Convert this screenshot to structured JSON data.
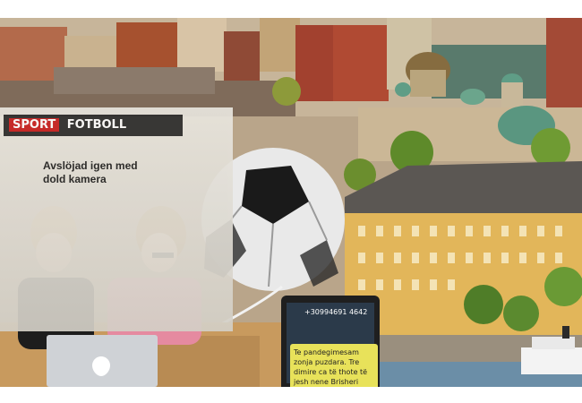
{
  "image": {
    "alt": "Collage: two women at a laptop, a soccer ball, a newspaper clipping and a phone text message overlaid on a city skyline",
    "colors": {
      "sky": "#d8cdb8",
      "roof_green": "#5f9d86",
      "building_yellow": "#e2b65a",
      "building_red": "#a24a36",
      "water": "#6b8ea7",
      "table_wood": "#c89a5e"
    }
  },
  "clipping": {
    "tag": "SPORT",
    "masthead": "FOTBOLL",
    "headline_line1": "Avslöjad igen med",
    "headline_line2": "dold kamera"
  },
  "phone": {
    "number": "+30994691 4642",
    "message": "Te pandegimesam zonja puzdara. Tre dimire ca të thote të jesh nene Brisheri trane"
  }
}
